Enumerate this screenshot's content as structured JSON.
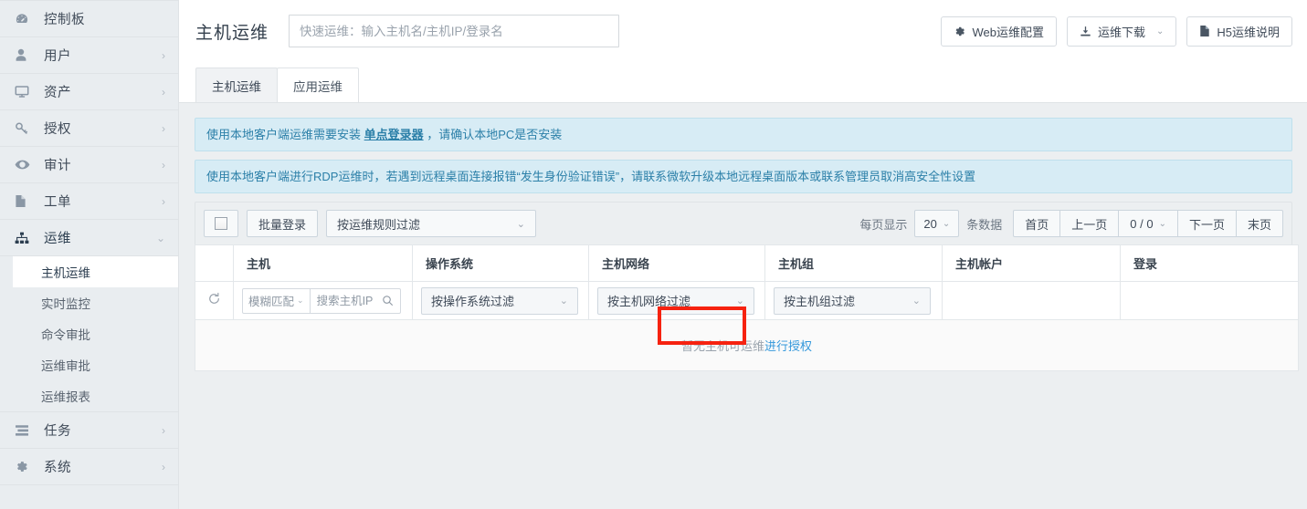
{
  "sidebar": {
    "items": [
      {
        "label": "控制板",
        "icon": "dashboard-icon",
        "expandable": false
      },
      {
        "label": "用户",
        "icon": "user-icon",
        "expandable": true
      },
      {
        "label": "资产",
        "icon": "monitor-icon",
        "expandable": true
      },
      {
        "label": "授权",
        "icon": "key-icon",
        "expandable": true
      },
      {
        "label": "审计",
        "icon": "eye-icon",
        "expandable": true
      },
      {
        "label": "工单",
        "icon": "document-icon",
        "expandable": true
      },
      {
        "label": "运维",
        "icon": "sitemap-icon",
        "expandable": true,
        "expanded": true
      },
      {
        "label": "任务",
        "icon": "tasks-icon",
        "expandable": true
      },
      {
        "label": "系统",
        "icon": "gear-icon",
        "expandable": true
      }
    ],
    "submenu": [
      {
        "label": "主机运维",
        "active": true
      },
      {
        "label": "实时监控",
        "active": false
      },
      {
        "label": "命令审批",
        "active": false
      },
      {
        "label": "运维审批",
        "active": false
      },
      {
        "label": "运维报表",
        "active": false
      }
    ],
    "chevron_collapsed": "›",
    "chevron_expanded": "⌄"
  },
  "header": {
    "title": "主机运维",
    "quick_search_placeholder": "快速运维：输入主机名/主机IP/登录名",
    "quick_search_value": "",
    "actions": [
      {
        "label": "Web运维配置",
        "icon": "gear-icon",
        "has_caret": false
      },
      {
        "label": "运维下载",
        "icon": "download-icon",
        "has_caret": true
      },
      {
        "label": "H5运维说明",
        "icon": "file-icon",
        "has_caret": false
      }
    ]
  },
  "tabs": [
    {
      "label": "主机运维",
      "active": true
    },
    {
      "label": "应用运维",
      "active": false
    }
  ],
  "alerts": [
    {
      "prefix": "使用本地客户端运维需要安装 ",
      "link": "单点登录器",
      "suffix": " ，请确认本地PC是否安装"
    },
    {
      "prefix": "使用本地客户端进行RDP运维时，若遇到远程桌面连接报错“发生身份验证错误”，请联系微软升级本地远程桌面版本或联系管理员取消高安全性设置",
      "link": "",
      "suffix": ""
    }
  ],
  "toolbar": {
    "select_all_checked": false,
    "batch_login_label": "批量登录",
    "rule_filter_label": "按运维规则过滤",
    "page_size_prefix": "每页显示",
    "page_size_value": "20",
    "page_size_suffix": "条数据",
    "pager": [
      {
        "label": "首页",
        "has_caret": false
      },
      {
        "label": "上一页",
        "has_caret": false
      },
      {
        "label": "0 / 0",
        "has_caret": true
      },
      {
        "label": "下一页",
        "has_caret": false
      },
      {
        "label": "末页",
        "has_caret": false
      }
    ]
  },
  "filters": {
    "reload_icon": "refresh-icon",
    "match_mode": "模糊匹配",
    "search_placeholder": "搜索主机IP",
    "search_value": "",
    "os_filter": "按操作系统过滤",
    "network_filter": "按主机网络过滤",
    "group_filter": "按主机组过滤"
  },
  "table": {
    "columns": [
      "主机",
      "操作系统",
      "主机网络",
      "主机组",
      "主机帐户",
      "登录"
    ],
    "rows": [],
    "empty_text": "暂无主机可运维",
    "empty_link": "进行授权"
  },
  "colors": {
    "accent": "#3498db",
    "alert_bg": "#d7ecf5",
    "alert_text": "#2b7fa8",
    "highlight_box": "#f62210",
    "page_bg": "#eceff1",
    "sidebar_bg": "#e9edf0"
  }
}
